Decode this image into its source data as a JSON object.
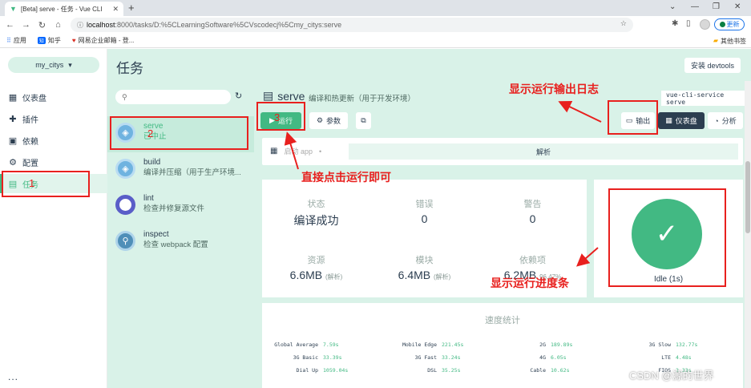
{
  "browser": {
    "tab_title": "[Beta] serve - 任务 - Vue CLI",
    "url_host": "localhost",
    "url_path": ":8000/tasks/D:%5CLearningSoftware%5CVscodecj%5Cmy_citys:serve",
    "update_label": "更新",
    "bookmarks": [
      "应用",
      "知乎",
      "网易企业邮箱 - 登..."
    ],
    "other_bookmarks": "其他书签"
  },
  "sidebar": {
    "project": "my_citys",
    "items": [
      {
        "label": "仪表盘",
        "icon": "dashboard-icon"
      },
      {
        "label": "插件",
        "icon": "puzzle-icon"
      },
      {
        "label": "依赖",
        "icon": "library-icon"
      },
      {
        "label": "配置",
        "icon": "settings-icon"
      },
      {
        "label": "任务",
        "icon": "assignment-icon"
      }
    ],
    "more": "..."
  },
  "header": {
    "title": "任务",
    "devtools_label": "安装 devtools"
  },
  "tasks": [
    {
      "name": "serve",
      "desc": "已中止"
    },
    {
      "name": "build",
      "desc": "编译并压缩（用于生产环境..."
    },
    {
      "name": "lint",
      "desc": "检查并修复源文件"
    },
    {
      "name": "inspect",
      "desc": "检查 webpack 配置"
    }
  ],
  "detail": {
    "title": "serve",
    "desc": "编译和热更新（用于开发环境）",
    "command": "vue-cli-service serve",
    "run_label": "运行",
    "params_label": "参数",
    "output_label": "输出",
    "dashboard_label": "仪表盘",
    "analysis_label": "分析",
    "status_app": "启动 app",
    "analysis_band": "解析"
  },
  "stats": {
    "status_label": "状态",
    "status_value": "编译成功",
    "errors_label": "错误",
    "errors_value": "0",
    "warnings_label": "警告",
    "warnings_value": "0",
    "assets_label": "资源",
    "assets_value": "6.6MB",
    "assets_sub": "(解析)",
    "modules_label": "模块",
    "modules_value": "6.4MB",
    "modules_sub": "(解析)",
    "deps_label": "依赖项",
    "deps_value": "6.2MB",
    "deps_sub": "96.47%",
    "idle_label": "Idle (1s)"
  },
  "speed": {
    "title": "速度统计",
    "rows": [
      [
        {
          "k": "Global Average",
          "v": "7.59s"
        },
        {
          "k": "Mobile Edge",
          "v": "221.45s"
        },
        {
          "k": "2G",
          "v": "189.89s"
        },
        {
          "k": "3G Slow",
          "v": "132.77s"
        }
      ],
      [
        {
          "k": "3G Basic",
          "v": "33.39s"
        },
        {
          "k": "3G Fast",
          "v": "33.24s"
        },
        {
          "k": "4G",
          "v": "6.05s"
        },
        {
          "k": "LTE",
          "v": "4.48s"
        }
      ],
      [
        {
          "k": "Dial Up",
          "v": "1059.04s"
        },
        {
          "k": "DSL",
          "v": "35.25s"
        },
        {
          "k": "Cable",
          "v": "10.62s"
        },
        {
          "k": "FIOS",
          "v": "2.33s"
        }
      ]
    ]
  },
  "annotations": {
    "log": "显示运行输出日志",
    "click_run": "直接点击运行即可",
    "progress": "显示运行进度条",
    "n1": "1",
    "n2": "2",
    "n3": "3"
  },
  "watermark": "CSDN @源的世界"
}
